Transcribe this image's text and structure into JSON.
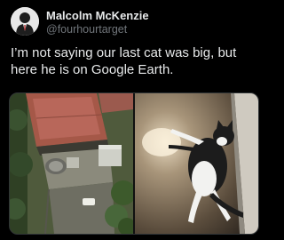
{
  "tweet": {
    "display_name": "Malcolm McKenzie",
    "handle": "@fourhourtarget",
    "text_lines": [
      "I’m not saying our last cat was big, but",
      "here he is on Google Earth."
    ]
  },
  "media": {
    "left_image_icon": "aerial-map-photo",
    "right_image_icon": "cat-photo"
  },
  "colors": {
    "background": "#000000",
    "text_primary": "#e7e9ea",
    "text_secondary": "#71767b"
  }
}
